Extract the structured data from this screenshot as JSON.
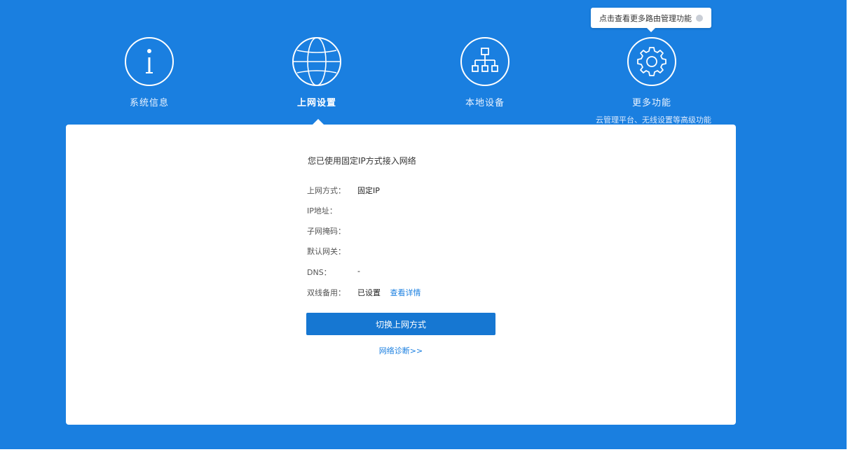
{
  "tooltip": {
    "text": "点击查看更多路由管理功能",
    "close_icon": "close-icon"
  },
  "nav": [
    {
      "label": "系统信息",
      "icon": "info-icon"
    },
    {
      "label": "上网设置",
      "icon": "globe-icon"
    },
    {
      "label": "本地设备",
      "icon": "network-icon"
    },
    {
      "label": "更多功能",
      "icon": "gear-icon",
      "sub": "云管理平台、无线设置等高级功能"
    }
  ],
  "panel": {
    "heading": "您已使用固定IP方式接入网络",
    "rows": [
      {
        "label": "上网方式：",
        "value": "固定IP"
      },
      {
        "label": "IP地址：",
        "value": ""
      },
      {
        "label": "子网掩码：",
        "value": ""
      },
      {
        "label": "默认网关：",
        "value": ""
      },
      {
        "label": "DNS：",
        "value": "-"
      },
      {
        "label": "双线备用：",
        "value": "已设置",
        "link": "查看详情"
      }
    ],
    "switch_button": "切换上网方式",
    "diagnose_link": "网络诊断>>"
  },
  "colors": {
    "background": "#1a7fe0",
    "panel": "#ffffff",
    "button": "#1677d2"
  }
}
